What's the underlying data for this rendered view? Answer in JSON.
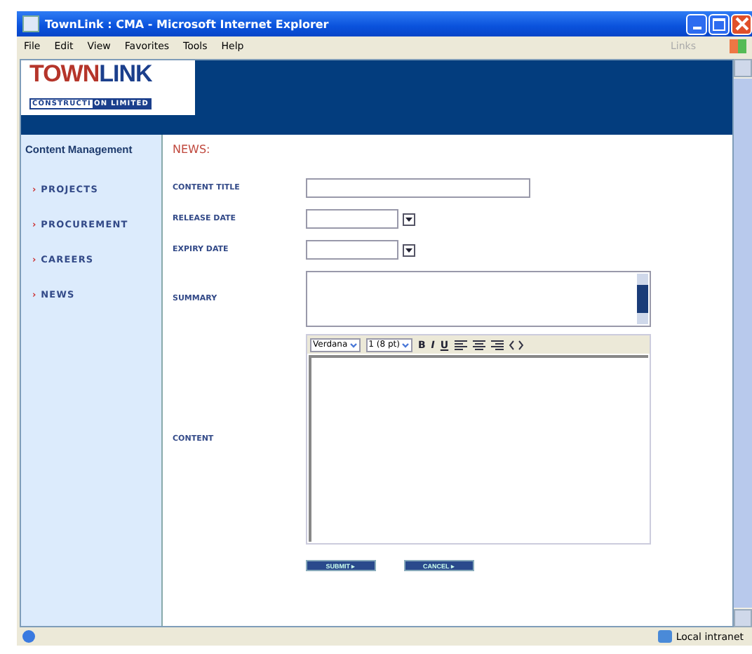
{
  "window": {
    "title": "TownLink : CMA - Microsoft Internet Explorer"
  },
  "menu": [
    "File",
    "Edit",
    "View",
    "Favorites",
    "Tools",
    "Help"
  ],
  "links_label": "Links",
  "logo": {
    "part_1": "TOWN",
    "part_2": "LINK",
    "sub_1": "CONSTRUCTI",
    "sub_2": "ON LIMITED"
  },
  "sidebar": {
    "title": "Content Management",
    "items": [
      {
        "marker": "›",
        "label": "PROJECTS"
      },
      {
        "marker": "›",
        "label": "PROCUREMENT"
      },
      {
        "marker": "›",
        "label": "CAREERS"
      },
      {
        "marker": "›",
        "label": "NEWS"
      }
    ]
  },
  "page_title": "NEWS:",
  "form": [
    {
      "kind": "text",
      "label": "CONTENT TITLE"
    },
    {
      "kind": "date",
      "label": "RELEASE DATE"
    },
    {
      "kind": "date",
      "label": "EXPIRY DATE"
    },
    {
      "kind": "textarea",
      "label": "SUMMARY"
    },
    {
      "kind": "editor",
      "label": "CONTENT",
      "font": "Verdana",
      "size": "1 (8 pt)",
      "tools": [
        "B",
        "I",
        "U"
      ]
    }
  ],
  "buttons": [
    "SUBMIT ▸",
    "CANCEL ▸"
  ],
  "status_bar": {
    "zone": "Local intranet"
  }
}
